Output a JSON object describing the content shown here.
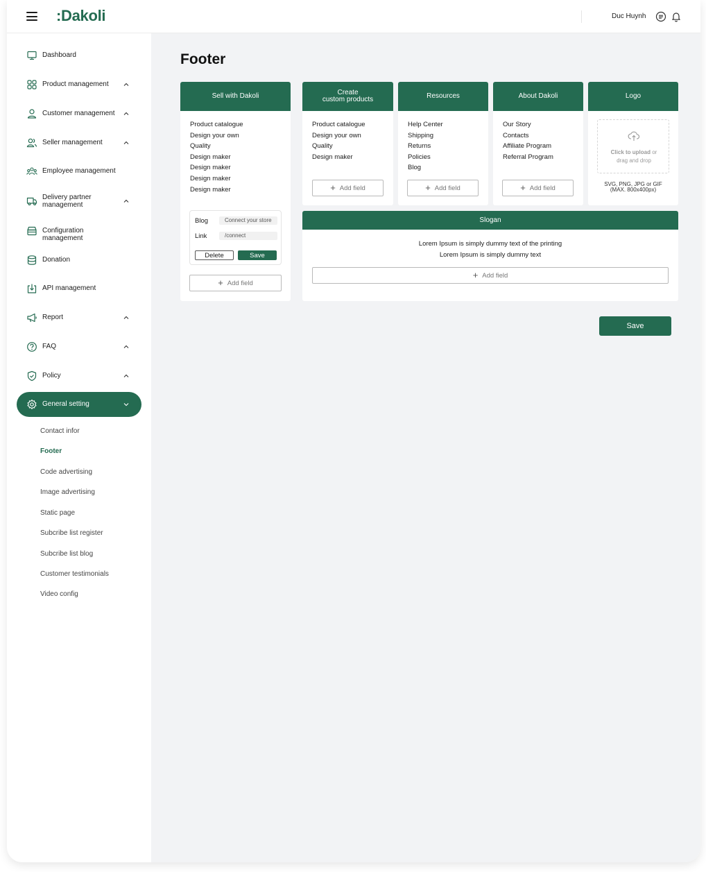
{
  "app": {
    "logo": ":Dakoli"
  },
  "topbar": {
    "user_name": "Duc Huynh"
  },
  "colors": {
    "brand": "#246b51",
    "background": "#f2f3f5"
  },
  "sidebar": {
    "items": [
      {
        "label": "Dashboard",
        "icon": "monitor-icon",
        "has_chevron": false
      },
      {
        "label": "Product management",
        "icon": "grid-icon",
        "has_chevron": true
      },
      {
        "label": "Customer management",
        "icon": "user-icon",
        "has_chevron": true
      },
      {
        "label": "Seller management",
        "icon": "users-icon",
        "has_chevron": true
      },
      {
        "label": "Employee management",
        "icon": "team-icon",
        "has_chevron": false
      },
      {
        "label": "Delivery partner management",
        "icon": "truck-icon",
        "has_chevron": true
      },
      {
        "label": "Configuration management",
        "icon": "box-icon",
        "has_chevron": false
      },
      {
        "label": "Donation",
        "icon": "database-icon",
        "has_chevron": false
      },
      {
        "label": "API management",
        "icon": "download-icon",
        "has_chevron": false
      },
      {
        "label": "Report",
        "icon": "megaphone-icon",
        "has_chevron": true
      },
      {
        "label": "FAQ",
        "icon": "help-circle-icon",
        "has_chevron": true
      },
      {
        "label": "Policy",
        "icon": "shield-check-icon",
        "has_chevron": true
      },
      {
        "label": "General setting",
        "icon": "gear-icon",
        "has_chevron": true,
        "active": true
      }
    ],
    "sub_items": [
      "Contact infor",
      "Footer",
      "Code advertising",
      "Image advertising",
      "Static page",
      "Subcribe list register",
      "Subcribe list blog",
      "Customer testimonials",
      "Video config"
    ],
    "current_sub": "Footer"
  },
  "page": {
    "title": "Footer",
    "save_label": "Save",
    "add_field_label": "Add field",
    "columns": {
      "sell": {
        "title": "Sell with Dakoli",
        "items": [
          "Product catalogue",
          "Design your own",
          "Quality",
          "Design maker",
          "Design maker",
          "Design maker",
          "Design maker"
        ]
      },
      "create": {
        "title_line1": "Create",
        "title_line2": "custom products",
        "items": [
          "Product catalogue",
          "Design your own",
          "Quality",
          "Design maker"
        ]
      },
      "resources": {
        "title": "Resources",
        "items": [
          "Help Center",
          "Shipping",
          "Returns",
          "Policies",
          "Blog"
        ]
      },
      "about": {
        "title": "About Dakoli",
        "items": [
          "Our Story",
          "Contacts",
          "Affiliate Program",
          "Referral Program"
        ]
      },
      "logo": {
        "title": "Logo",
        "upload_strong": "Click to upload",
        "upload_or": "or",
        "upload_drag": "drag and drop",
        "formats_line1": "SVG, PNG, JPG or GIF",
        "formats_line2": "(MAX. 800x400px)"
      }
    },
    "edit_form": {
      "name_label": "Blog",
      "name_value": "Connect your store",
      "link_label": "Link",
      "link_value": "/connect",
      "delete_label": "Delete",
      "save_label": "Save"
    },
    "slogan": {
      "title": "Slogan",
      "line1": "Lorem Ipsum is simply dummy text of the printing",
      "line2": "Lorem Ipsum is simply dummy text"
    }
  }
}
